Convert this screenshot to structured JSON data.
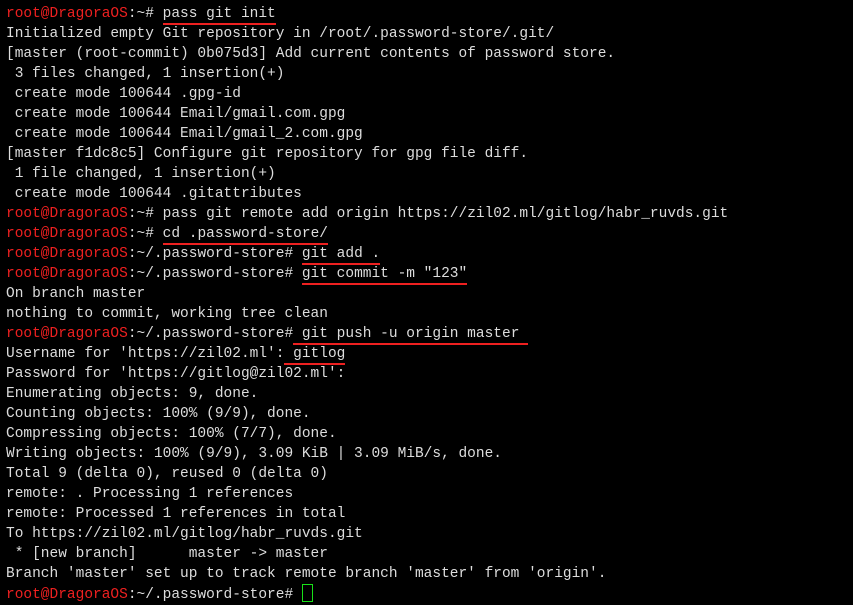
{
  "prompt1": "root@DragoraOS",
  "pathHome": ":~#",
  "pathStore": ":~/.password-store#",
  "cmd": {
    "pass_git_init": "pass git init",
    "remote_add": "pass git remote add origin https://zil02.ml/gitlog/habr_ruvds.git",
    "cd_store": "cd .password-store/",
    "git_add": "git add .",
    "git_commit": "git commit -m \"123\"",
    "git_push": " git push -u origin master ",
    "username_val": " gitlog"
  },
  "out": {
    "l1": "Initialized empty Git repository in /root/.password-store/.git/",
    "l2": "[master (root-commit) 0b075d3] Add current contents of password store.",
    "l3": " 3 files changed, 1 insertion(+)",
    "l4": " create mode 100644 .gpg-id",
    "l5": " create mode 100644 Email/gmail.com.gpg",
    "l6": " create mode 100644 Email/gmail_2.com.gpg",
    "l7": "[master f1dc8c5] Configure git repository for gpg file diff.",
    "l8": " 1 file changed, 1 insertion(+)",
    "l9": " create mode 100644 .gitattributes",
    "l10": "On branch master",
    "l11": "nothing to commit, working tree clean",
    "l12": "Username for 'https://zil02.ml':",
    "l13": "Password for 'https://gitlog@zil02.ml':",
    "l14": "Enumerating objects: 9, done.",
    "l15": "Counting objects: 100% (9/9), done.",
    "l16": "Compressing objects: 100% (7/7), done.",
    "l17": "Writing objects: 100% (9/9), 3.09 KiB | 3.09 MiB/s, done.",
    "l18": "Total 9 (delta 0), reused 0 (delta 0)",
    "l19": "remote: . Processing 1 references",
    "l20": "remote: Processed 1 references in total",
    "l21": "To https://zil02.ml/gitlog/habr_ruvds.git",
    "l22": " * [new branch]      master -> master",
    "l23": "Branch 'master' set up to track remote branch 'master' from 'origin'."
  }
}
